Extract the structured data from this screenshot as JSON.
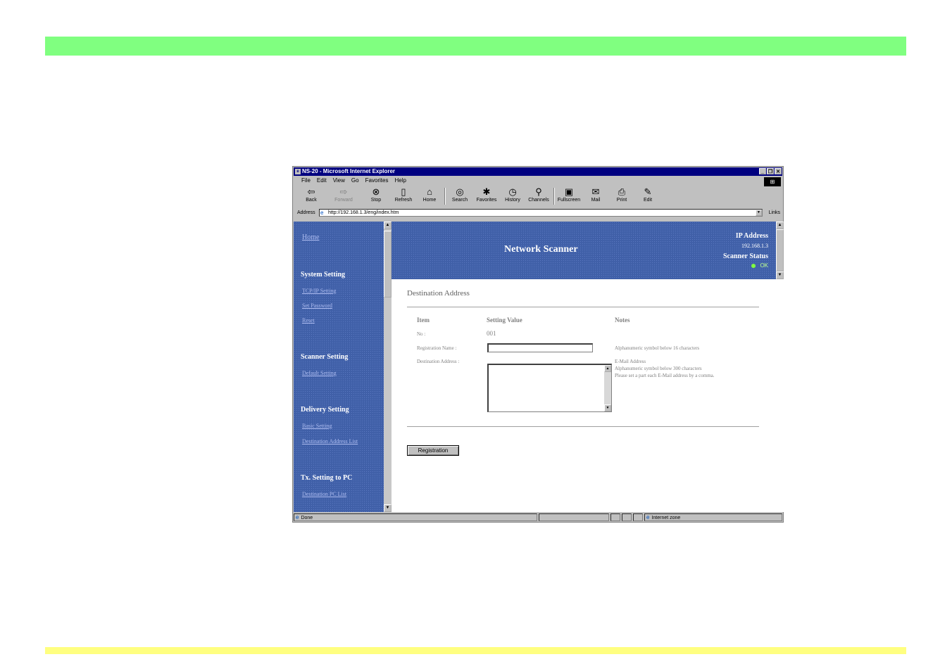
{
  "window": {
    "title": "NS-20 - Microsoft Internet Explorer",
    "controls": [
      "_",
      "❐",
      "✕"
    ]
  },
  "menu": [
    "File",
    "Edit",
    "View",
    "Go",
    "Favorites",
    "Help"
  ],
  "toolbar": {
    "back": "Back",
    "forward": "Forward",
    "stop": "Stop",
    "refresh": "Refresh",
    "home": "Home",
    "search": "Search",
    "favorites": "Favorites",
    "history": "History",
    "channels": "Channels",
    "fullscreen": "Fullscreen",
    "mail": "Mail",
    "print": "Print",
    "edit": "Edit"
  },
  "address": {
    "label": "Address",
    "url": "http://192.168.1.3/eng/index.htm",
    "links": "Links"
  },
  "sidebar": {
    "home": "Home",
    "system_setting": "System Setting",
    "tcpip": "TCP/IP Setting",
    "set_password": "Set Password",
    "reset": "Reset",
    "scanner_setting": "Scanner Setting",
    "default_setting": "Default Setting",
    "delivery_setting": "Delivery Setting",
    "basic_setting": "Basic Setting",
    "dest_address_list": "Destination Address List",
    "tx_setting": "Tx. Setting to PC",
    "dest_pc_list": "Destination PC List"
  },
  "header": {
    "title": "Network Scanner",
    "ip_label": "IP Address",
    "ip_value": "192.168.1.3",
    "status_label": "Scanner Status",
    "status_value": "OK",
    "status_color": "#80ff40"
  },
  "form": {
    "title": "Destination Address",
    "col_item": "Item",
    "col_value": "Setting Value",
    "col_notes": "Notes",
    "no_label": "No :",
    "no_value": "001",
    "reg_name_label": "Registration Name :",
    "reg_name_value": "",
    "reg_name_note": "Alphanumeric symbol below 16 characters",
    "dest_label": "Destination Address :",
    "dest_value": "",
    "dest_note1": "E-Mail Address",
    "dest_note2": "Alphanumeric symbol below 300 characters",
    "dest_note3": "Please set a part each E-Mail address by a comma.",
    "register_button": "Registration"
  },
  "statusbar": {
    "text": "Done",
    "zone": "Internet zone"
  },
  "colors": {
    "top_band": "#80ff80",
    "bottom_band": "#ffff80",
    "sidebar_bg": "#4060a8"
  }
}
